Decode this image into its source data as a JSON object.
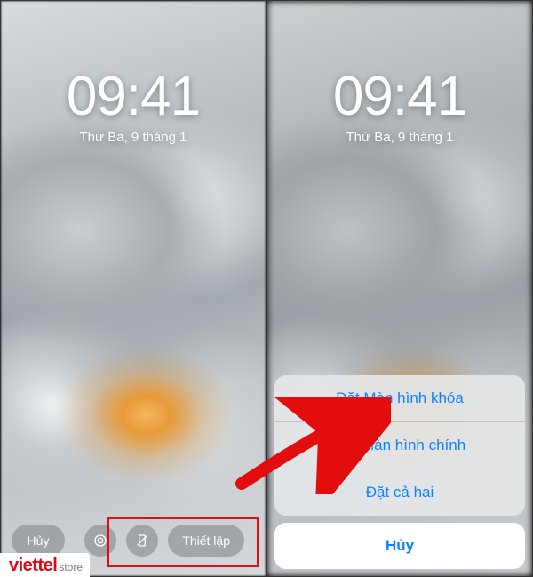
{
  "clock": {
    "time": "09:41",
    "date": "Thứ Ba, 9 tháng 1"
  },
  "left_screen": {
    "cancel_label": "Hủy",
    "setup_label": "Thiết lập"
  },
  "right_screen": {
    "menu": {
      "set_lock": "Đặt Màn hình khóa",
      "set_home": "Đặt Màn hình chính",
      "set_both": "Đặt cả hai"
    },
    "cancel": "Hủy"
  },
  "watermark": {
    "brand": "viettel",
    "sub": "store"
  }
}
